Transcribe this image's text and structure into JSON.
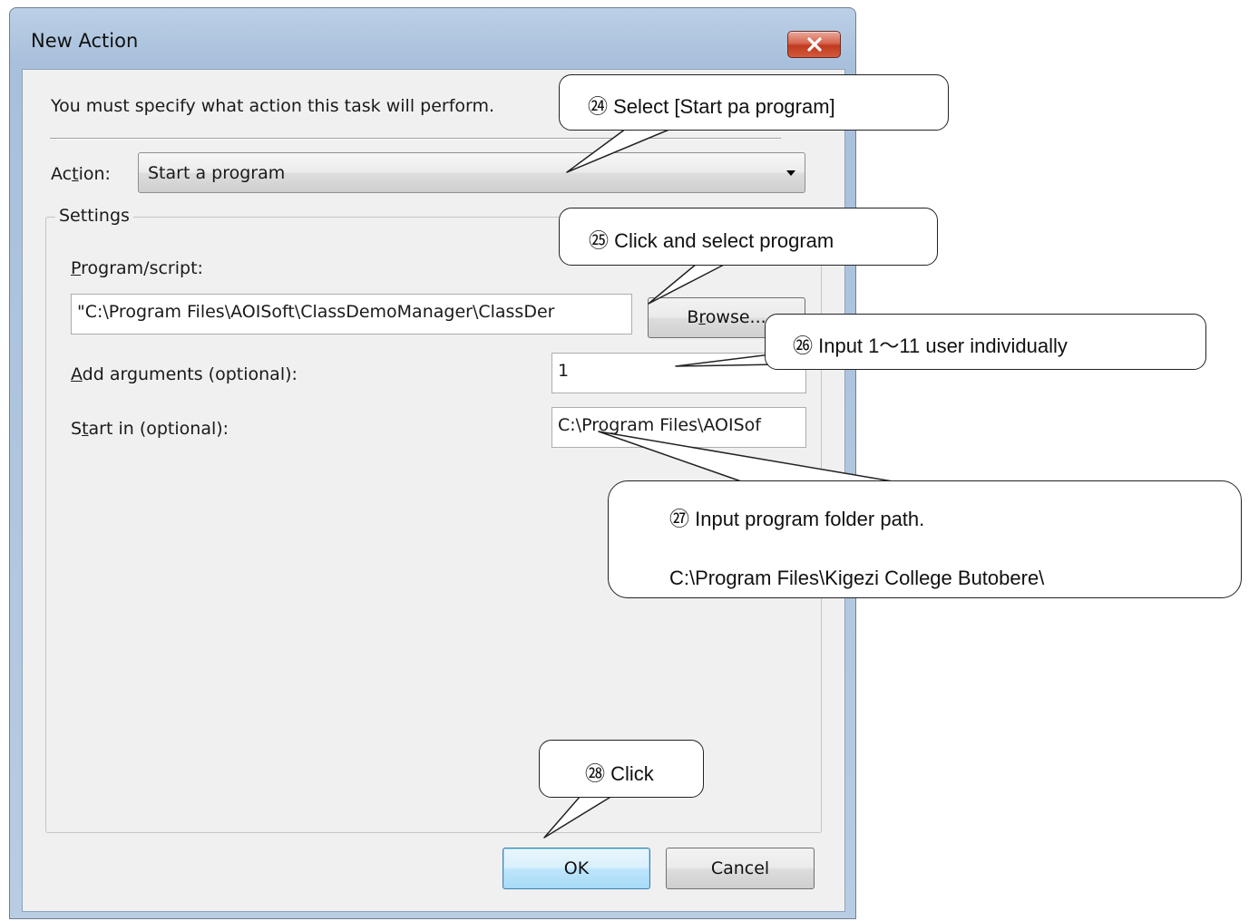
{
  "window": {
    "title": "New Action"
  },
  "dialog": {
    "intro": "You must specify what action this task will perform.",
    "action_label_pre": "Ac",
    "action_label_ul": "t",
    "action_label_post": "ion:",
    "action_value": "Start a program",
    "settings_title": "Settings",
    "program_label_ul": "P",
    "program_label_post": "rogram/script:",
    "program_value": "\"C:\\Program Files\\AOISoft\\ClassDemoManager\\ClassDer",
    "browse_pre": "B",
    "browse_ul": "r",
    "browse_post": "owse...",
    "args_label_ul": "A",
    "args_label_post": "dd arguments (optional):",
    "args_value": "1",
    "startin_label_pre": "S",
    "startin_label_ul": "t",
    "startin_label_post": "art in (optional):",
    "startin_value": "C:\\Program Files\\AOISof",
    "ok_label": "OK",
    "cancel_label": "Cancel"
  },
  "callouts": {
    "c24": "㉔ Select [Start pa program]",
    "c25": "㉕ Click and select program",
    "c26": "㉖ Input 1～11 user individually",
    "c27_line1": "㉗ Input program folder path.",
    "c27_line2": "C:\\Program Files\\Kigezi College Butobere\\",
    "c28": "㉘ Click"
  },
  "colors": {
    "close_button": "#c8452b",
    "title_bar": "#a8c0dc",
    "dialog_bg": "#f0f0f0"
  },
  "icons": {
    "close": "close-x-icon",
    "dropdown": "chevron-down-icon"
  }
}
